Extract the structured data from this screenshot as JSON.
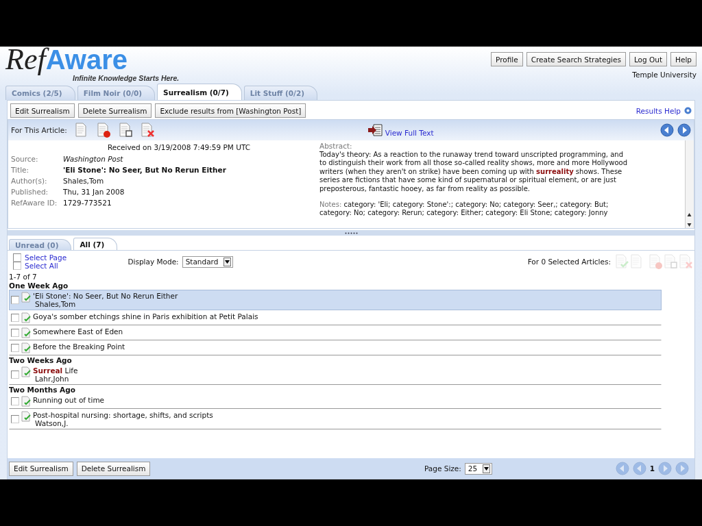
{
  "header": {
    "logo_first": "Ref",
    "logo_second": "Aware",
    "tagline": "Infinite Knowledge Starts Here.",
    "top_buttons": [
      "Profile",
      "Create Search Strategies",
      "Log Out",
      "Help"
    ],
    "institution": "Temple University"
  },
  "tabs": [
    {
      "label": "Comics (2/5)",
      "selected": false
    },
    {
      "label": "Film Noir (0/0)",
      "selected": false
    },
    {
      "label": "Surrealism (0/7)",
      "selected": true
    },
    {
      "label": "Lit Stuff (0/2)",
      "selected": false
    }
  ],
  "toolbar": {
    "buttons": [
      "Edit Surrealism",
      "Delete Surrealism",
      "Exclude results from [Washington Post]"
    ],
    "help_link": "Results Help"
  },
  "article": {
    "label": "For This Article:",
    "view_full_text": "View Full Text",
    "received": "Received on 3/19/2008 7:49:59 PM UTC",
    "fields": [
      {
        "label": "Source:",
        "value": "Washington Post",
        "kind": "italic"
      },
      {
        "label": "Title:",
        "value": "'Eli Stone': No Seer, But No Rerun Either",
        "kind": "bold"
      },
      {
        "label": "Author(s):",
        "value": "Shales,Tom",
        "kind": "plain"
      },
      {
        "label": "Published:",
        "value": "Thu, 31 Jan 2008",
        "kind": "plain"
      },
      {
        "label": "RefAware ID:",
        "value": "1729-773521",
        "kind": "plain"
      }
    ],
    "abstract_label": "Abstract:",
    "abstract": "Today's theory: As a reaction to the runaway trend toward unscripted programming, and to distinguish their work from all those so-called reality shows, more and more Hollywood writers (when they aren't on strike) have been coming up with **surreality** shows. These series are fictions that have some kind of supernatural or spiritual element, or are just preposterous, fantastic hooey, as far from reality as possible.",
    "notes_label": "Notes:",
    "notes": "category: 'Eli; category: Stone':; category: No; category: Seer,; category: But; category: No; category: Rerun; category: Either; category: Eli Stone; category: Jonny"
  },
  "list_tabs": [
    {
      "label": "Unread (0)",
      "selected": false
    },
    {
      "label": "All (7)",
      "selected": true
    }
  ],
  "list_controls": {
    "select_page": {
      "label": "Select Page",
      "checked": false
    },
    "select_all": {
      "label": "Select All",
      "checked": false
    },
    "display_mode_label": "Display Mode:",
    "display_mode_value": "Standard",
    "selected_articles_label": "For 0 Selected Articles:"
  },
  "range": "1-7 of 7",
  "groups": [
    {
      "heading": "One Week Ago",
      "items": [
        {
          "title": "'Eli Stone': No Seer, But No Rerun Either",
          "author": "Shales,Tom",
          "selected": true,
          "checked": false
        },
        {
          "title": "Goya's somber etchings shine in Paris exhibition at Petit Palais",
          "selected": false,
          "checked": false
        },
        {
          "title": "Somewhere East of Eden",
          "selected": false,
          "checked": false
        },
        {
          "title": "Before the Breaking Point",
          "selected": false,
          "checked": false
        }
      ]
    },
    {
      "heading": "Two Weeks Ago",
      "items": [
        {
          "title": "**Surreal** Life",
          "author": "Lahr,John",
          "selected": false,
          "checked": false
        }
      ]
    },
    {
      "heading": "Two Months Ago",
      "items": [
        {
          "title": "Running out of time",
          "selected": false,
          "checked": false
        },
        {
          "title": "Post-hospital nursing: shortage, shifts, and scripts",
          "author": "Watson,J.",
          "selected": false,
          "checked": false
        }
      ]
    }
  ],
  "footer": {
    "buttons": [
      "Edit Surrealism",
      "Delete Surrealism"
    ],
    "page_size_label": "Page Size:",
    "page_size_value": "25",
    "page": "1"
  }
}
